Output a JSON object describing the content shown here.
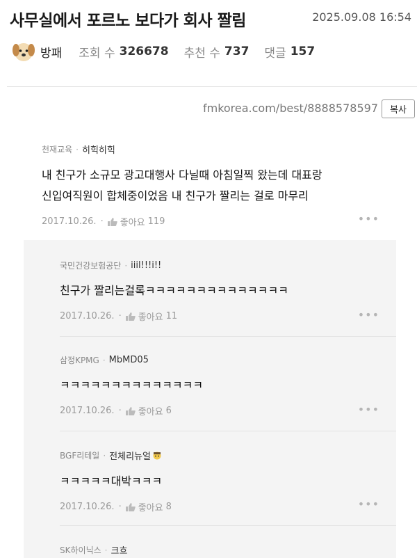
{
  "post": {
    "title": "사무실에서 포르노 보다가 회사 짤림",
    "date": "2025.09.08 16:54",
    "author": "방패",
    "views_label": "조회 수",
    "views": "326678",
    "likes_label": "추천 수",
    "likes": "737",
    "comments_label": "댓글",
    "comments": "157"
  },
  "source": {
    "url": "fmkorea.com/best/8888578597",
    "copy_label": "복사"
  },
  "top_comment": {
    "company": "천재교육",
    "nick": "히힉히힉",
    "lines": [
      "내 친구가 소규모 광고대행사 다닐때 아침일찍 왔는데 대표랑",
      "신입여직원이 합체중이었음 내 친구가 짤리는 걸로 마무리"
    ],
    "date": "2017.10.26.",
    "like_label": "좋아요",
    "like_count": "119"
  },
  "replies": [
    {
      "company": "국민건강보험공단",
      "nick": "iiil!!!i!!",
      "body": "친구가 짤리는걸록ㅋㅋㅋㅋㅋㅋㅋㅋㅋㅋㅋㅋㅋㅋ",
      "date": "2017.10.26.",
      "like_label": "좋아요",
      "like_count": "11"
    },
    {
      "company": "삼정KPMG",
      "nick": "MbMD05",
      "body": "ㅋㅋㅋㅋㅋㅋㅋㅋㅋㅋㅋㅋㅋㅋ",
      "date": "2017.10.26.",
      "like_label": "좋아요",
      "like_count": "6"
    },
    {
      "company": "BGF리테일",
      "nick": "전체리뉴얼",
      "body": "ㅋㅋㅋㅋㅋ대박ㅋㅋㅋ",
      "date": "2017.10.26.",
      "like_label": "좋아요",
      "like_count": "8"
    },
    {
      "company": "SK하이닉스",
      "nick": "크흐"
    }
  ],
  "icons": {
    "avatar": "puppy-avatar-icon",
    "thumb": "thumbs-up-icon",
    "more": "more-dots-icon",
    "nick_badge": "person-emoji-icon"
  },
  "colors": {
    "reply_bg": "#f4f4f4",
    "muted": "#888888"
  }
}
